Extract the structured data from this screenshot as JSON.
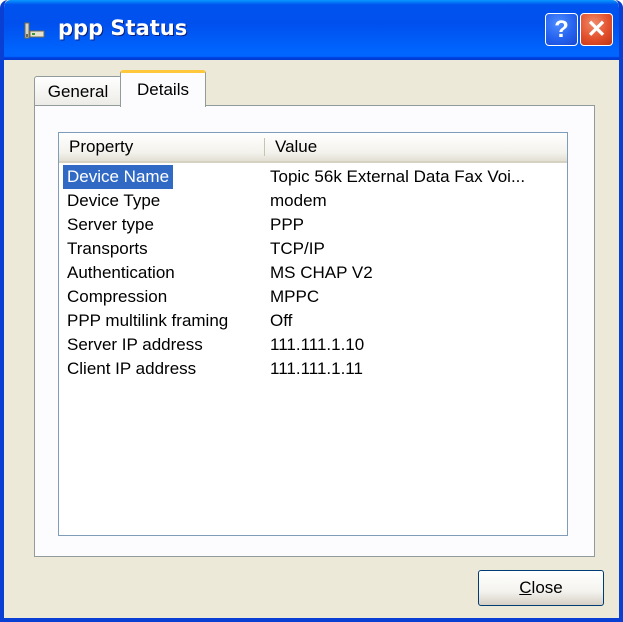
{
  "window": {
    "title": "ppp Status",
    "help_button": "?",
    "close_button": "✕"
  },
  "tabs": [
    {
      "label": "General",
      "selected": false
    },
    {
      "label": "Details",
      "selected": true
    }
  ],
  "list": {
    "columns": [
      "Property",
      "Value"
    ],
    "rows": [
      {
        "property": "Device Name",
        "value": "Topic 56k External Data Fax Voi...",
        "selected": true
      },
      {
        "property": "Device Type",
        "value": "modem"
      },
      {
        "property": "Server type",
        "value": "PPP"
      },
      {
        "property": "Transports",
        "value": "TCP/IP"
      },
      {
        "property": "Authentication",
        "value": "MS CHAP V2"
      },
      {
        "property": "Compression",
        "value": "MPPC"
      },
      {
        "property": "PPP multilink framing",
        "value": "Off"
      },
      {
        "property": "Server IP address",
        "value": "111.111.1.10"
      },
      {
        "property": "Client IP address",
        "value": "111.111.1.11"
      }
    ]
  },
  "buttons": {
    "close_first": "C",
    "close_rest": "lose"
  },
  "colors": {
    "titlebar": "#0053ee",
    "selection": "#316ac5",
    "tab_accent": "#ffc83c",
    "close_red": "#e2502c"
  },
  "icons": {
    "title": "network-connection-icon",
    "help": "help-icon",
    "close": "close-icon"
  }
}
